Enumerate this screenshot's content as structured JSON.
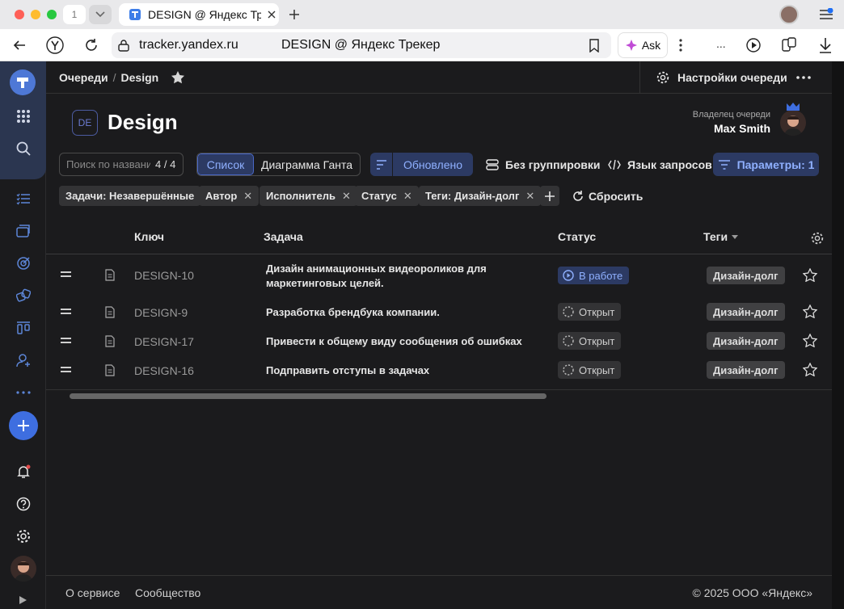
{
  "browser": {
    "tab_count": "1",
    "tab_title": "DESIGN @ Яндекс Трекер",
    "url": "tracker.yandex.ru",
    "page_title": "DESIGN @ Яндекс Трекер",
    "ask_label": "Ask",
    "more_label": "..."
  },
  "header": {
    "breadcrumb_root": "Очереди",
    "breadcrumb_sep": "/",
    "breadcrumb_current": "Design",
    "queue_settings": "Настройки очереди"
  },
  "queue": {
    "icon_text": "DE",
    "title": "Design",
    "owner_label": "Владелец очереди",
    "owner_name": "Max Smith"
  },
  "toolbar": {
    "search_placeholder": "Поиск по названию",
    "search_count": "4 / 4",
    "view_list": "Список",
    "view_gantt": "Диаграмма Ганта",
    "sort_label": "Обновлено",
    "grouping": "Без группировки",
    "query_language": "Язык запросов",
    "params": "Параметры: 1"
  },
  "filters": {
    "chips": [
      "Задачи: Незавершённые",
      "Автор",
      "Исполнитель",
      "Статус",
      "Теги: Дизайн-долг"
    ],
    "reset": "Сбросить"
  },
  "table": {
    "columns": {
      "key": "Ключ",
      "task": "Задача",
      "status": "Статус",
      "tags": "Теги"
    },
    "rows": [
      {
        "key": "DESIGN-10",
        "task_line1": "Дизайн анимационных видеороликов для",
        "task_line2": "маркетинговых целей.",
        "status": "В работе",
        "tag": "Дизайн-долг"
      },
      {
        "key": "DESIGN-9",
        "task": "Разработка брендбука компании.",
        "status": "Открыт",
        "tag": "Дизайн-долг"
      },
      {
        "key": "DESIGN-17",
        "task": "Привести к общему виду сообщения об ошибках",
        "status": "Открыт",
        "tag": "Дизайн-долг"
      },
      {
        "key": "DESIGN-16",
        "task": "Подправить отступы в задачах",
        "status": "Открыт",
        "tag": "Дизайн-долг"
      }
    ]
  },
  "footer": {
    "about": "О сервисе",
    "community": "Сообщество",
    "copyright": "© 2025 ООО «Яндекс»"
  },
  "colors": {
    "accent": "#8fb0ff",
    "accent_bg": "#2c3a63",
    "bg": "#1b1b1d"
  },
  "icons": [
    "tracker-logo-icon",
    "apps-icon",
    "search-icon",
    "tasks-icon",
    "projects-icon",
    "goals-icon",
    "queues-icon",
    "boards-icon",
    "add-user-icon",
    "more-icon",
    "create-icon",
    "notifications-icon",
    "help-icon",
    "settings-icon",
    "star-icon",
    "gear-icon",
    "filter-icon",
    "sort-icon",
    "group-icon",
    "code-icon",
    "reset-icon",
    "document-icon",
    "drag-icon"
  ]
}
